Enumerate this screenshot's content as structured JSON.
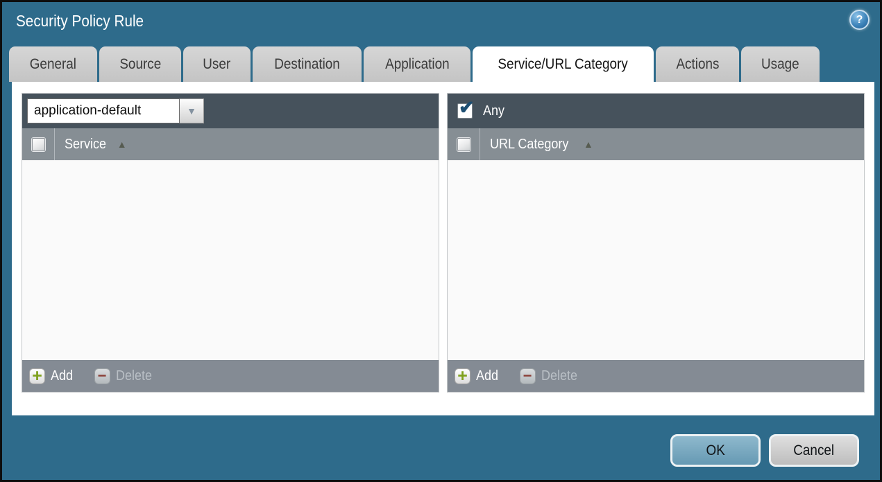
{
  "window": {
    "title": "Security Policy Rule"
  },
  "icons": {
    "help": "?",
    "dropdown_arrow": "▼",
    "sort_ascending": "▲",
    "add_plus": "+",
    "delete_minus": "−",
    "checkmark": "✔"
  },
  "tabs": [
    {
      "label": "General",
      "active": false
    },
    {
      "label": "Source",
      "active": false
    },
    {
      "label": "User",
      "active": false
    },
    {
      "label": "Destination",
      "active": false
    },
    {
      "label": "Application",
      "active": false
    },
    {
      "label": "Service/URL Category",
      "active": true
    },
    {
      "label": "Actions",
      "active": false
    },
    {
      "label": "Usage",
      "active": false
    }
  ],
  "service_panel": {
    "service_type_value": "application-default",
    "column_header": "Service",
    "add_label": "Add",
    "delete_label": "Delete",
    "delete_enabled": false,
    "rows": []
  },
  "url_category_panel": {
    "any_label": "Any",
    "any_checked": true,
    "column_header": "URL Category",
    "add_label": "Add",
    "delete_label": "Delete",
    "delete_enabled": false,
    "rows": []
  },
  "footer": {
    "ok_label": "OK",
    "cancel_label": "Cancel"
  },
  "colors": {
    "dialog_background": "#2e6b8b",
    "panel_toolbar": "#46525c",
    "column_header_bar": "#868e94",
    "footer_toolbar": "#848b94",
    "ok_button": "#75a7c0",
    "cancel_button": "#cccccc",
    "add_icon_green": "#7fa11c",
    "delete_icon_red": "#8b4038",
    "checkmark_blue": "#1d4f73",
    "active_tab": "#ffffff",
    "inactive_tab": "#cbcbcb"
  }
}
